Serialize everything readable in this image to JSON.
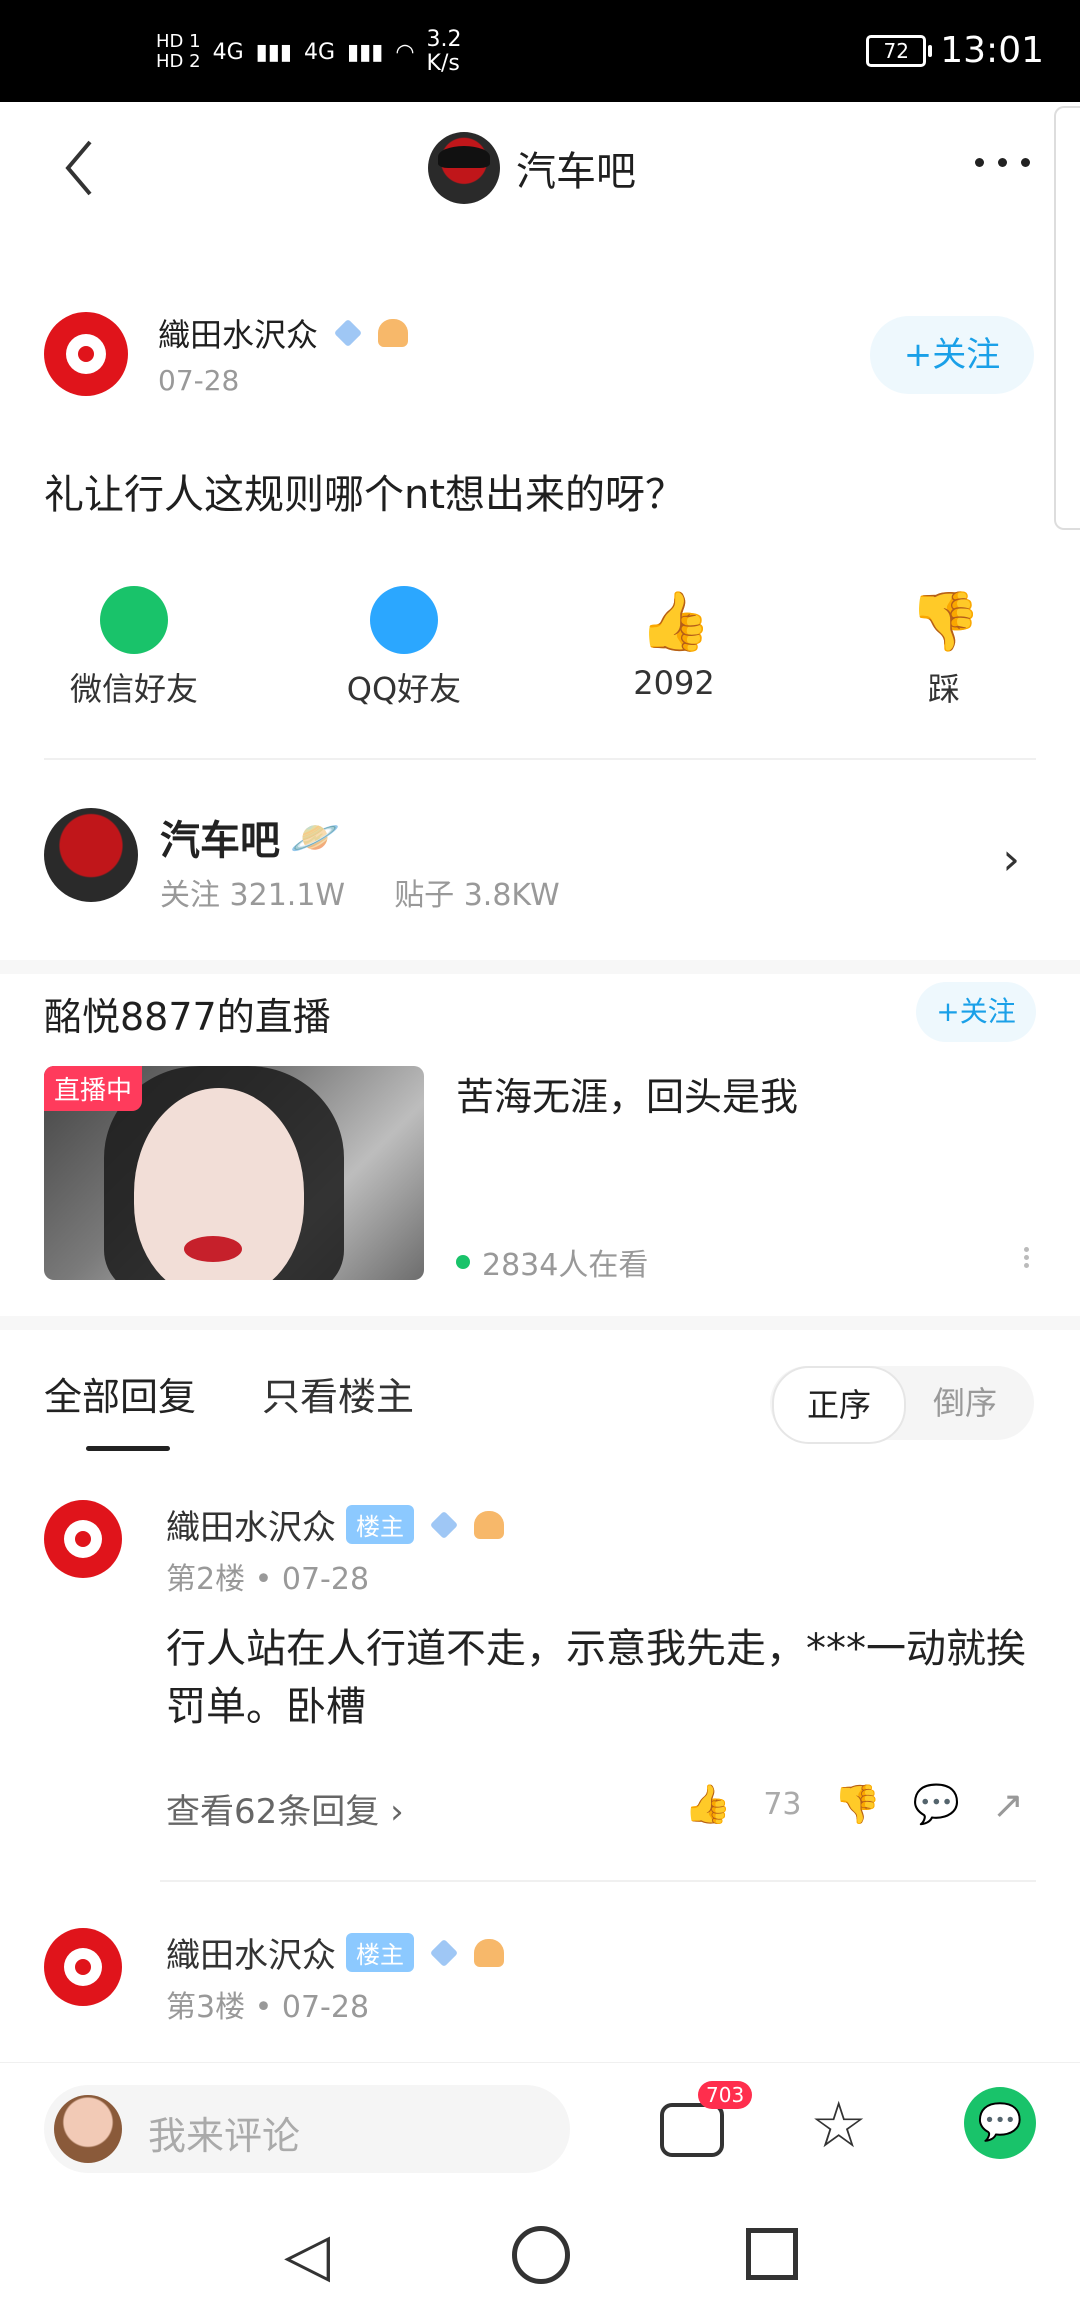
{
  "status_bar": {
    "hd1": "HD 1",
    "hd2": "HD 2",
    "net1": "4G",
    "net2": "4G",
    "speed": "3.2",
    "speed_unit": "K/s",
    "battery": "72",
    "time": "13:01"
  },
  "top_bar": {
    "title": "汽车吧"
  },
  "post": {
    "author": "織田水沢众",
    "date": "07-28",
    "follow_label": "+关注",
    "title": "礼让行人这规则哪个nt想出来的呀？"
  },
  "share": {
    "wechat_label": "微信好友",
    "qq_label": "QQ好友",
    "likes": "2092",
    "dislike_label": "踩"
  },
  "forum": {
    "name": "汽车吧",
    "followers": "关注 321.1W",
    "posts": "贴子 3.8KW"
  },
  "live": {
    "header": "酩悦8877的直播",
    "follow_label": "+关注",
    "badge": "直播中",
    "title": "苦海无涯，回头是我",
    "viewers": "2834人在看"
  },
  "reply_tabs": {
    "all": "全部回复",
    "host_only": "只看楼主",
    "sort_asc": "正序",
    "sort_desc": "倒序"
  },
  "replies": [
    {
      "author": "織田水沢众",
      "tag": "楼主",
      "floor_date": "第2楼 • 07-28",
      "text": "行人站在人行道不走，示意我先走，***一动就挨罚单。卧槽",
      "more_replies": "查看62条回复 ›",
      "likes": "73"
    },
    {
      "author": "織田水沢众",
      "tag": "楼主",
      "floor_date": "第3楼 • 07-28"
    }
  ],
  "bottom_bar": {
    "comment_placeholder": "我来评论",
    "comment_count": "703"
  },
  "colors": {
    "accent_blue": "#1aa0e8",
    "wechat_green": "#19c36a",
    "qq_blue": "#2ba7ff",
    "live_red": "#ff3b5c",
    "badge_red": "#ff2e4d"
  }
}
